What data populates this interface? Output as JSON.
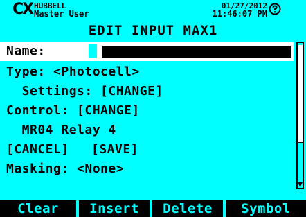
{
  "header": {
    "brand": "HUBBELL",
    "logo": "CX",
    "user": "Master User",
    "date": "01/27/2012",
    "time": "11:46:07 PM",
    "help_icon": "question-circle-icon"
  },
  "title": "EDIT INPUT MAX1",
  "name_field": {
    "label": "Name:",
    "value": ""
  },
  "rows": {
    "type": "Type: <Photocell>",
    "settings": "  Settings: [CHANGE]",
    "control": "Control: [CHANGE]",
    "relay": "  MR04 Relay 4",
    "actions_cancel": "[CANCEL]",
    "actions_save": "[SAVE]",
    "masking": "Masking: <None>"
  },
  "softkeys": {
    "clear": "Clear",
    "insert": "Insert",
    "delete": "Delete",
    "symbol": "Symbol"
  },
  "colors": {
    "background": "#00ffff",
    "highlight": "#ffffff",
    "text": "#000000"
  },
  "scrollbar": {
    "thumb_fraction": 0.66
  }
}
